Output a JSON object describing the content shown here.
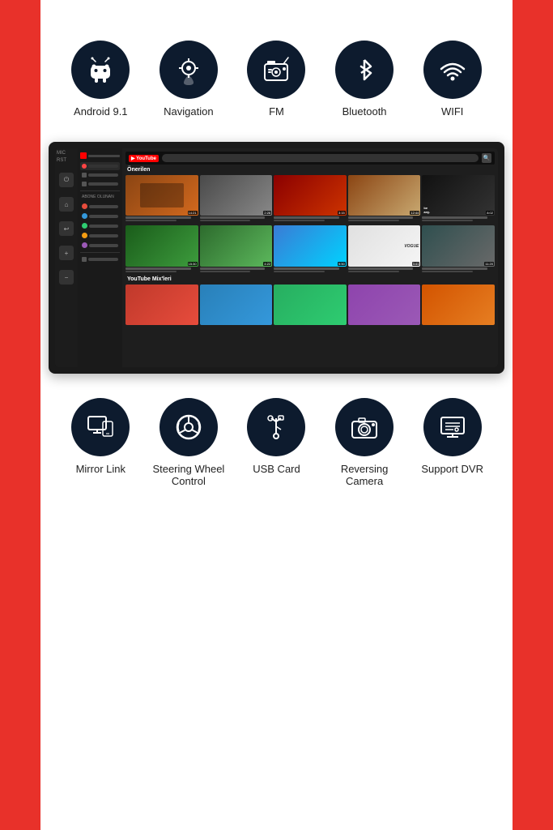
{
  "page": {
    "background": "#ffffff",
    "accent_color": "#e8312a"
  },
  "top_features": [
    {
      "id": "android",
      "label": "Android 9.1",
      "icon": "android"
    },
    {
      "id": "navigation",
      "label": "Navigation",
      "icon": "navigation"
    },
    {
      "id": "fm",
      "label": "FM",
      "icon": "fm"
    },
    {
      "id": "bluetooth",
      "label": "Bluetooth",
      "icon": "bluetooth"
    },
    {
      "id": "wifi",
      "label": "WIFI",
      "icon": "wifi"
    }
  ],
  "bottom_features": [
    {
      "id": "mirror-link",
      "label": "Mirror Link",
      "icon": "mirror"
    },
    {
      "id": "steering-wheel",
      "label": "Steering Wheel Control",
      "icon": "steering"
    },
    {
      "id": "usb-card",
      "label": "USB Card",
      "icon": "usb"
    },
    {
      "id": "reversing-camera",
      "label": "Reversing Camera",
      "icon": "camera"
    },
    {
      "id": "support-dvr",
      "label": "Support DVR",
      "icon": "dvr"
    }
  ],
  "device": {
    "label_mic": "MIC",
    "label_rst": "RST",
    "youtube_label": "YouTube",
    "section_recommended": "Önerilen",
    "section_mixes": "YouTube Mix'leri"
  }
}
